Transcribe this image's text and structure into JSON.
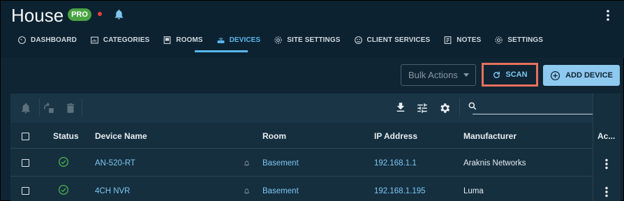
{
  "header": {
    "title": "House",
    "badge": "PRO",
    "status_color": "#e04141",
    "icons": [
      "bell-icon",
      "more-vert-icon"
    ]
  },
  "tabs": [
    {
      "label": "DASHBOARD",
      "icon": "speedometer-icon",
      "active": false
    },
    {
      "label": "CATEGORIES",
      "icon": "category-icon",
      "active": false
    },
    {
      "label": "ROOMS",
      "icon": "rooms-icon",
      "active": false
    },
    {
      "label": "DEVICES",
      "icon": "router-icon",
      "active": true
    },
    {
      "label": "SITE SETTINGS",
      "icon": "gear-icon",
      "active": false
    },
    {
      "label": "CLIENT SERVICES",
      "icon": "support-icon",
      "active": false
    },
    {
      "label": "NOTES",
      "icon": "notes-icon",
      "active": false
    },
    {
      "label": "SETTINGS",
      "icon": "gear-icon",
      "active": false
    }
  ],
  "actions": {
    "bulk_label": "Bulk Actions",
    "scan_label": "SCAN",
    "add_label": "ADD DEVICE",
    "highlight_color": "#e8705c"
  },
  "table": {
    "columns": [
      "Status",
      "Device Name",
      "Room",
      "IP Address",
      "Manufacturer",
      "Ac..."
    ],
    "rows": [
      {
        "status": "online",
        "name": "AN-520-RT",
        "room": "Basement",
        "ip": "192.168.1.1",
        "manufacturer": "Araknis Networks"
      },
      {
        "status": "online",
        "name": "4CH NVR",
        "room": "Basement",
        "ip": "192.168.1.195",
        "manufacturer": "Luma"
      }
    ]
  },
  "colors": {
    "accent": "#59b7f0",
    "link": "#7ec6f1",
    "ok": "#4caf50",
    "background": "#0f2533"
  }
}
